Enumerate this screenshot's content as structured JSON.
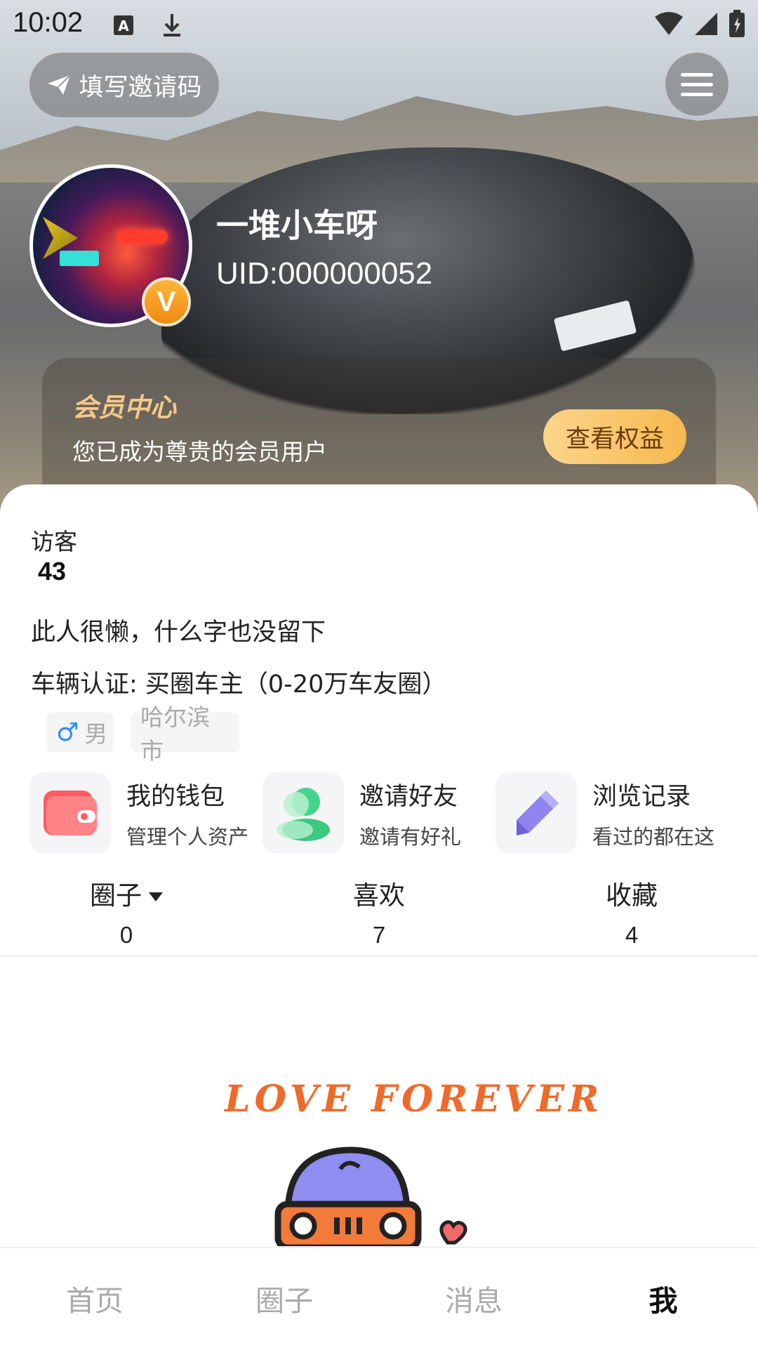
{
  "status_bar": {
    "time": "10:02",
    "icons": [
      "text-a-icon",
      "download-icon",
      "wifi-icon",
      "signal-icon",
      "battery-icon"
    ]
  },
  "header": {
    "invite_button_label": "填写邀请码",
    "menu_icon": "hamburger-menu-icon"
  },
  "profile": {
    "username": "一堆小车呀",
    "uid": "UID:000000052",
    "vip_badge": "V"
  },
  "member_card": {
    "title": "会员中心",
    "subtitle": "您已成为尊贵的会员用户",
    "button_label": "查看权益",
    "accent_color": "#f7b84f"
  },
  "visitors": {
    "label": "访客",
    "count": "43"
  },
  "bio": "此人很懒，什么字也没留下",
  "vehicle_auth": "车辆认证:  买圈车主（0-20万车友圈）",
  "tags": {
    "gender_symbol": "♂",
    "gender": "男",
    "city": "哈尔滨市"
  },
  "actions": [
    {
      "title": "我的钱包",
      "subtitle": "管理个人资产",
      "icon": "wallet-icon"
    },
    {
      "title": "邀请好友",
      "subtitle": "邀请有好礼",
      "icon": "friends-icon"
    },
    {
      "title": "浏览记录",
      "subtitle": "看过的都在这",
      "icon": "pencil-icon"
    }
  ],
  "stats": [
    {
      "label": "圈子",
      "value": "0"
    },
    {
      "label": "喜欢",
      "value": "7"
    },
    {
      "label": "收藏",
      "value": "4"
    }
  ],
  "illustration": {
    "text": "LOVE   FOREVER"
  },
  "bottom_nav": [
    {
      "label": "首页",
      "active": false
    },
    {
      "label": "圈子",
      "active": false
    },
    {
      "label": "消息",
      "active": false
    },
    {
      "label": "我",
      "active": true
    }
  ]
}
